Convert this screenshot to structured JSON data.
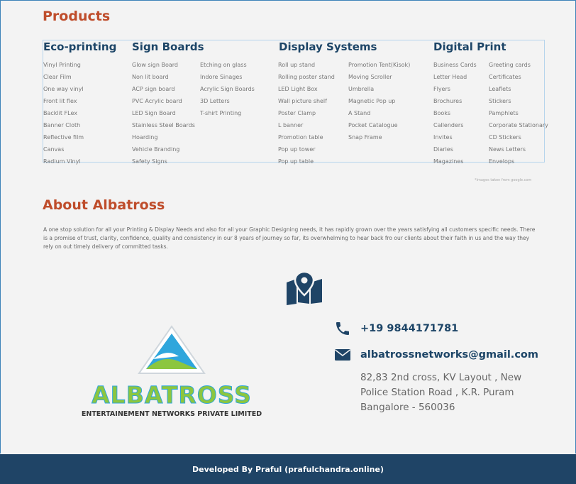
{
  "products": {
    "heading": "Products",
    "categories": [
      {
        "title": "Eco-printing",
        "items": [
          "Vinyl Printing",
          "Clear Film",
          "One way vinyl",
          "Front lit flex",
          "Backlit FLex",
          "Banner Cloth",
          "Reflective film",
          "Canvas",
          "Radium Vinyl"
        ]
      },
      {
        "title": "Sign Boards",
        "items": [
          "Glow sign Board",
          "Non lit board",
          "ACP sign board",
          "PVC Acrylic board",
          "LED Sign Board",
          "Stainless Steel Boards",
          "Hoarding",
          "Vehicle Branding",
          "Safety Signs"
        ],
        "items2": [
          "Etching on glass",
          "Indore Sinages",
          "Acrylic Sign Boards",
          "3D Letters",
          "T-shirt Printing"
        ]
      },
      {
        "title": "Display Systems",
        "items": [
          "Roll up stand",
          "Rolling poster stand",
          "LED Light Box",
          "Wall picture shelf",
          "Poster Clamp",
          "L banner",
          "Promotion table",
          "Pop up tower",
          "Pop up table"
        ],
        "items2": [
          "Promotion Tent(Kisok)",
          "Moving Scroller",
          "Umbrella",
          "Magnetic Pop up",
          "A Stand",
          "Pocket Catalogue",
          "Snap Frame"
        ]
      },
      {
        "title": "Digital Print",
        "items": [
          "Business Cards",
          "Letter Head",
          "Flyers",
          "Brochures",
          "Books",
          "Callenders",
          "Invites",
          "Diaries",
          "Magazines"
        ],
        "items2": [
          "Greeting cards",
          "Certificates",
          "Leaflets",
          "Stickers",
          "Pamphlets",
          "Corporate Stationary",
          "CD Stickers",
          "News Letters",
          "Envelops"
        ]
      }
    ],
    "image_note": "*Images taken from google.com"
  },
  "about": {
    "heading": "About Albatross",
    "text": "A one stop solution for all your Printing & Display Needs and also for all your Graphic Designing needs, it has rapidly grown over the years satisfying all customers specific needs. There is a promise of trust, clarity, confidence, quality and consistency in our 8 years of journey so far, its overwhelming to hear back fro our clients about their faith in us and the way they rely on out timely delivery of committed tasks."
  },
  "logo": {
    "name": "ALBATROSS",
    "subtitle": "ENTERTAINEMENT NETWORKS PRIVATE LIMITED"
  },
  "contact": {
    "map_icon": "map-marker-icon",
    "phone_icon": "phone-icon",
    "email_icon": "envelope-icon",
    "phone": "+19 9844171781",
    "email": "albatrossnetworks@gmail.com",
    "address": [
      "82,83 2nd cross, KV Layout , New",
      "Police Station Road , K.R. Puram",
      "Bangalore - 560036"
    ]
  },
  "footer": {
    "text": "Developed By Praful (prafulchandra.online)"
  },
  "colors": {
    "accent": "#bf4d2b",
    "navy": "#1f4466",
    "background": "#f3f3f3"
  }
}
